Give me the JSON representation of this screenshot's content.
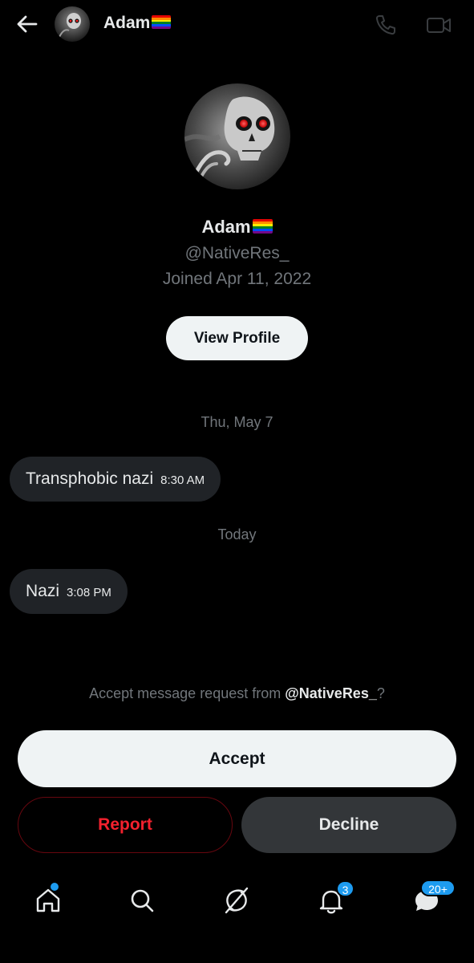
{
  "header": {
    "back_icon": "arrow-left-icon",
    "name": "Adam",
    "flag": "rainbow-flag",
    "call_icon": "phone-icon",
    "video_icon": "video-camera-icon"
  },
  "profile": {
    "name": "Adam",
    "handle": "@NativeRes_",
    "joined": "Joined Apr 11, 2022",
    "view_profile_label": "View Profile"
  },
  "conversation": [
    {
      "date": "Thu, May 7",
      "message": "Transphobic nazi",
      "time": "8:30 AM"
    },
    {
      "date": "Today",
      "message": "Nazi",
      "time": "3:08 PM"
    }
  ],
  "request": {
    "prefix": "Accept message request from ",
    "handle": "@NativeRes_",
    "suffix": "?",
    "accept_label": "Accept",
    "report_label": "Report",
    "decline_label": "Decline"
  },
  "nav": {
    "items": [
      "home-icon",
      "search-icon",
      "grok-icon",
      "notifications-icon",
      "messages-icon"
    ],
    "notifications_badge": "3",
    "messages_badge": "20+"
  },
  "colors": {
    "background": "#000000",
    "accent": "#1d9bf0",
    "report": "#f4212e",
    "bubble": "#202327",
    "muted_text": "#71767b"
  }
}
